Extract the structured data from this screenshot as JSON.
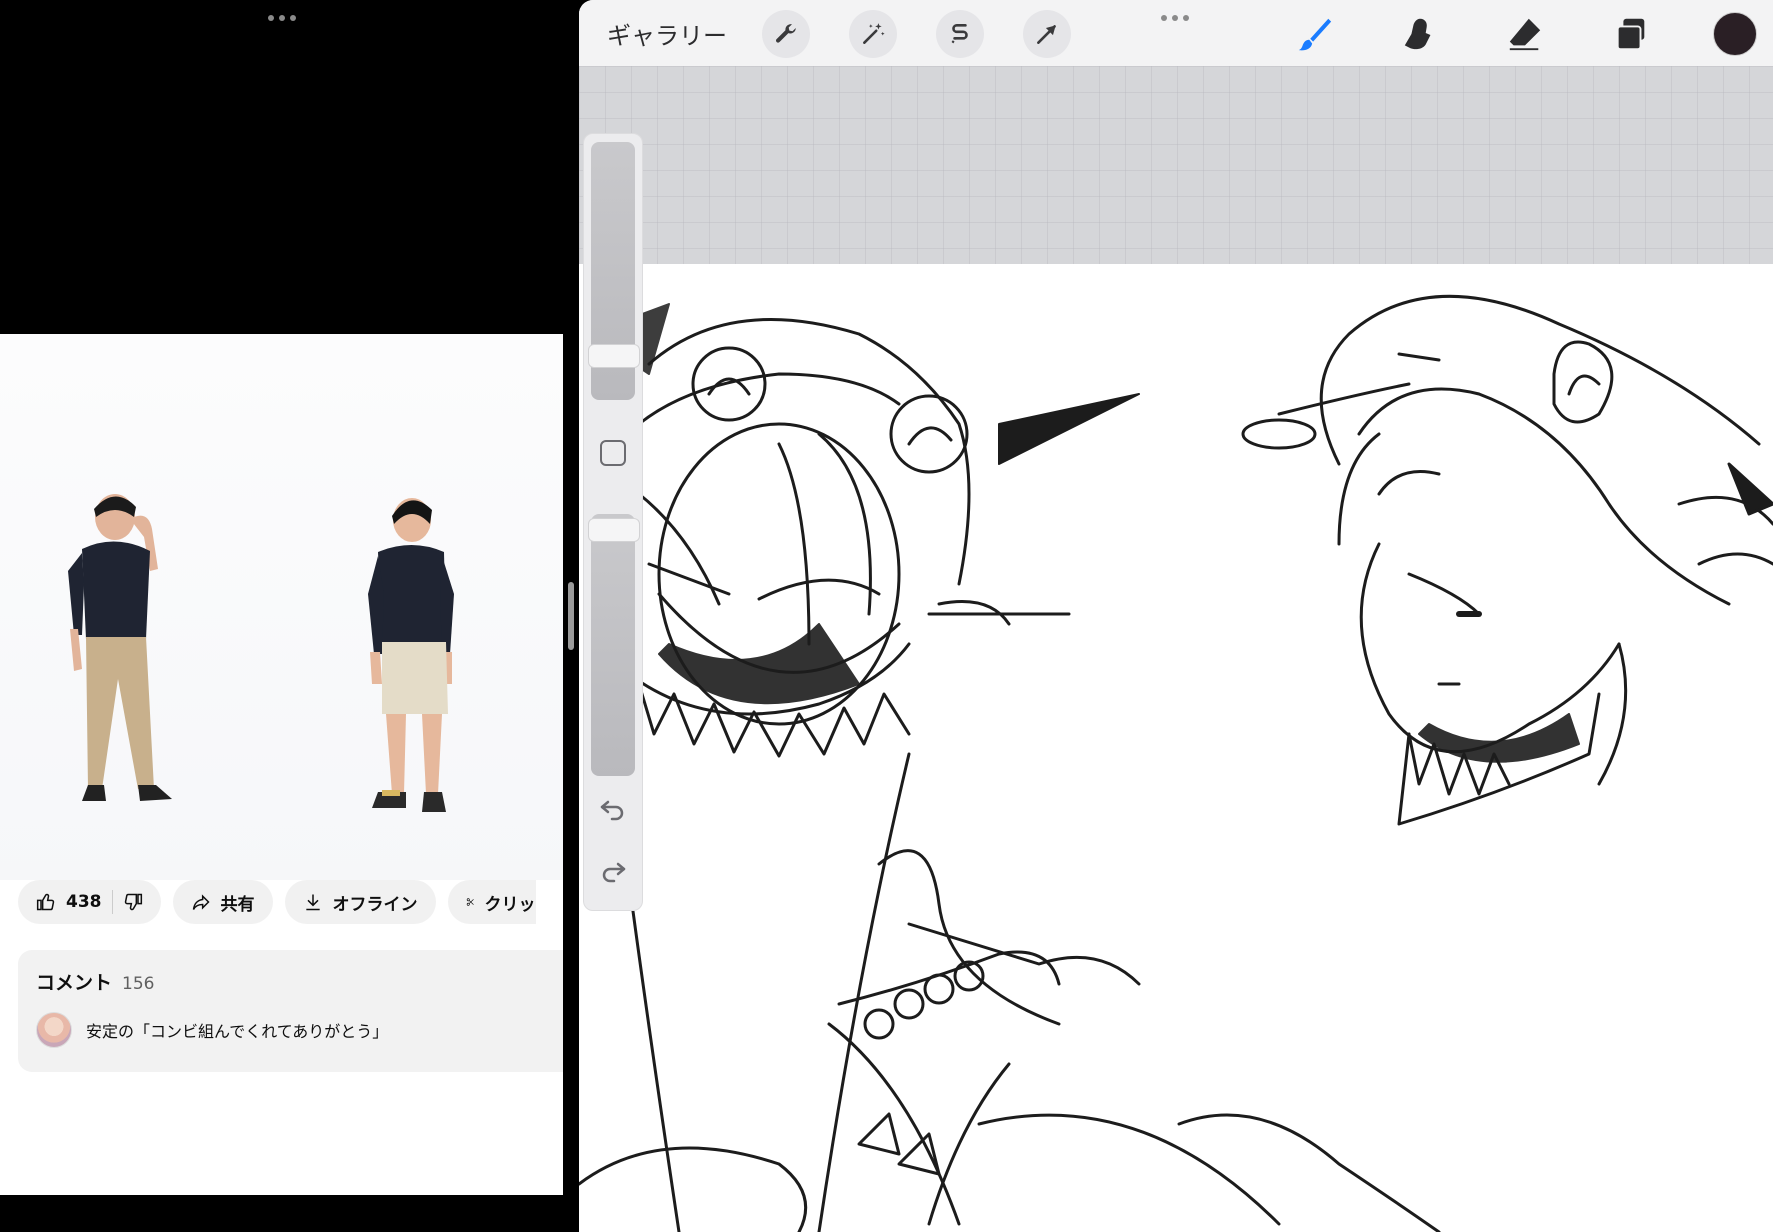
{
  "video_app": {
    "actions": {
      "like_count": "438",
      "share_label": "共有",
      "offline_label": "オフライン",
      "clip_label": "クリッ"
    },
    "comments": {
      "title": "コメント",
      "count": "156",
      "top_comment": "安定の「コンビ組んでくれてありがとう」"
    }
  },
  "drawing_app": {
    "toolbar": {
      "gallery_label": "ギャラリー",
      "tools_left": [
        "wrench-icon",
        "magic-wand-icon",
        "selection-icon",
        "transform-arrow-icon"
      ],
      "tools_right": [
        "brush-icon",
        "smudge-icon",
        "eraser-icon",
        "layers-icon"
      ],
      "active_tool": "brush-icon",
      "active_color": "#2a1f25",
      "accent_color": "#1a7cff"
    }
  }
}
